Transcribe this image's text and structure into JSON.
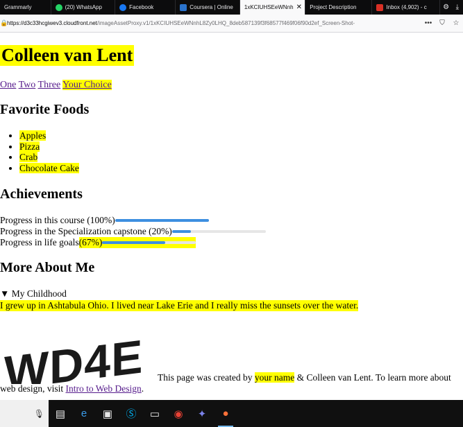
{
  "browser": {
    "tabs": [
      {
        "label": "Grammarly",
        "icon": "grammarly-icon",
        "color": "#15c39a",
        "active": false,
        "close": ""
      },
      {
        "label": "(20) WhatsApp",
        "icon": "whatsapp-icon",
        "color": "#25d366",
        "active": false,
        "close": ""
      },
      {
        "label": "Facebook",
        "icon": "facebook-icon",
        "color": "#1877f2",
        "active": false,
        "close": ""
      },
      {
        "label": "Coursera | Online",
        "icon": "coursera-icon",
        "color": "#2a73cc",
        "active": false,
        "close": ""
      },
      {
        "label": "1xKCIUHSEeWNnh",
        "icon": "image-icon",
        "color": "#9a9a9a",
        "active": true,
        "close": "✕"
      },
      {
        "label": "Project Description",
        "icon": "page-icon",
        "color": "#0c0c0d",
        "active": false,
        "close": ""
      },
      {
        "label": "Inbox (4,902) - c",
        "icon": "gmail-icon",
        "color": "#d93025",
        "active": false,
        "close": ""
      }
    ],
    "url_host": "https://d3c33hcgiwev3.cloudfront.net",
    "url_path": "/imageAssetProxy.v1/1xKCIUHSEeWNnhL8Zy0LHQ_8deb587139f3f68577f469f06f90d2ef_Screen-Shot-",
    "url_buttons": [
      "•••",
      "⛉",
      "☆"
    ]
  },
  "page": {
    "name": "Colleen van Lent",
    "nav": [
      "One",
      "Two",
      "Three",
      "Your Choice"
    ],
    "foods_heading": "Favorite Foods",
    "foods": [
      "Apples",
      "Pizza",
      "Crab",
      "Chocolate Cake"
    ],
    "achievements_heading": "Achievements",
    "progress": [
      {
        "label": "Progress in this course (100%)",
        "value": 100,
        "highlight": false
      },
      {
        "label": "Progress in the Specialization capstone (20%)",
        "value": 20,
        "highlight": false
      },
      {
        "label_pre": "Progress in life goals ",
        "label_hl": "(67%)",
        "value": 67,
        "highlight": true
      }
    ],
    "more_heading": "More About Me",
    "details_summary": "My Childhood",
    "details_text": "I grew up in Ashtabula Ohio. I lived near Lake Erie and I really miss the sunsets over the water.",
    "logo_text": "WD4E",
    "footer": {
      "pre": "This page was created by ",
      "your_name": "your name",
      "mid": " & Colleen van Lent. To learn more about",
      "line2_pre": "web design, visit ",
      "link": "Intro to Web Design",
      "end": "."
    }
  },
  "colors": {
    "highlight": "#ffff00",
    "progress_fill": "#3d8fe0",
    "link_visited": "#551a8b"
  },
  "taskbar": [
    "search-icon",
    "task-view-icon",
    "edge-icon",
    "store-icon",
    "skype-icon",
    "terminal-icon",
    "chrome-icon",
    "teams-icon",
    "firefox-icon"
  ]
}
